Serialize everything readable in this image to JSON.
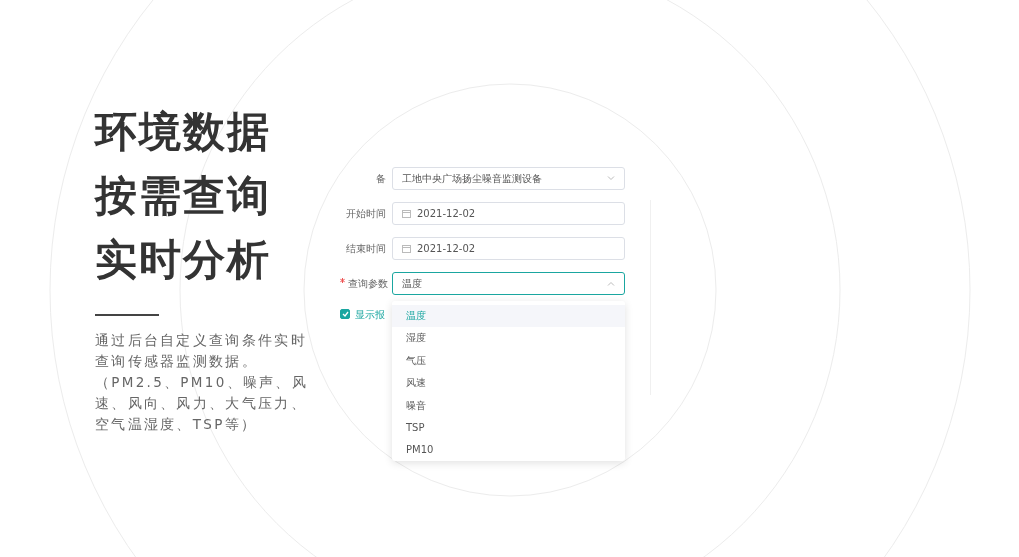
{
  "headline": [
    "环境数据",
    "按需查询",
    "实时分析"
  ],
  "description": "通过后台自定义查询条件实时查询传感器监测数据。（PM2.5、PM10、噪声、风速、风向、风力、大气压力、空气温湿度、TSP等）",
  "form": {
    "fields": [
      {
        "kind": "select",
        "label": "备",
        "required": false,
        "value": "工地中央广场扬尘噪音监测设备",
        "focused": false
      },
      {
        "kind": "date",
        "label": "开始时间",
        "required": false,
        "value": "2021-12-02",
        "focused": false
      },
      {
        "kind": "date",
        "label": "结束时间",
        "required": false,
        "value": "2021-12-02",
        "focused": false
      },
      {
        "kind": "select",
        "label": "查询参数",
        "required": true,
        "value": "温度",
        "focused": true,
        "expanded": true
      }
    ],
    "checkbox": {
      "label": "显示报",
      "checked": true
    },
    "dropdown": [
      {
        "label": "温度",
        "selected": true
      },
      {
        "label": "湿度",
        "selected": false
      },
      {
        "label": "气压",
        "selected": false
      },
      {
        "label": "风速",
        "selected": false
      },
      {
        "label": "噪音",
        "selected": false
      },
      {
        "label": "TSP",
        "selected": false
      },
      {
        "label": "PM10",
        "selected": false
      }
    ]
  }
}
